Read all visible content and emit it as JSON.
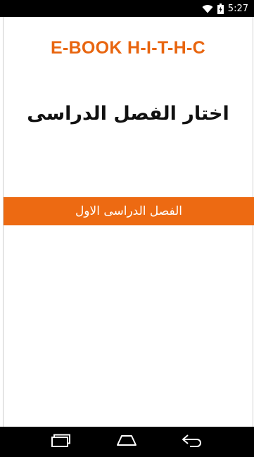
{
  "status_bar": {
    "time": "5:27",
    "icons": [
      "wifi-icon",
      "battery-icon"
    ]
  },
  "app": {
    "title": "E-BOOK H-I-T-H-C",
    "heading": "اختار الفصل الدراسى",
    "semester_button_label": "الفصل الدراسى الاول"
  },
  "nav_bar": {
    "icons": [
      "recent-apps-icon",
      "home-icon",
      "back-icon"
    ]
  },
  "colors": {
    "accent": "#ed6a12",
    "title": "#e8650f"
  }
}
